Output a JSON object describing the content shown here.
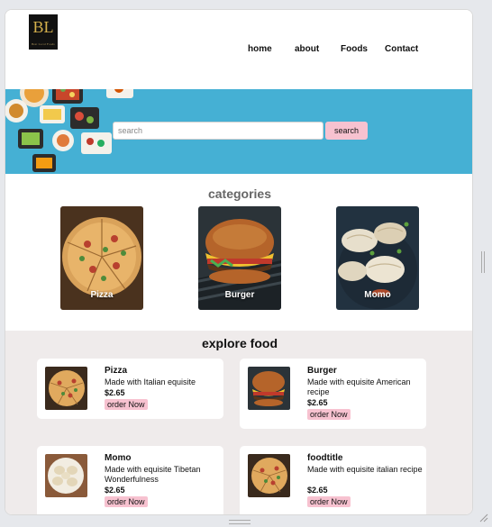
{
  "header": {
    "logo_text": "BL",
    "logo_tagline": "Best Local Foods",
    "nav": [
      "home",
      "about",
      "Foods",
      "Contact"
    ]
  },
  "hero": {
    "search_placeholder": "search",
    "search_button": "search"
  },
  "categories": {
    "title": "categories",
    "items": [
      "Pizza",
      "Burger",
      "Momo"
    ]
  },
  "explore": {
    "title": "explore food",
    "items": [
      {
        "name": "Pizza",
        "desc": "Made with Italian equisite",
        "price": "$2.65",
        "button": "order Now",
        "image": "pizza-image"
      },
      {
        "name": "Burger",
        "desc": "Made with equisite American recipe",
        "price": "$2.65",
        "button": "order Now",
        "image": "burger-image"
      },
      {
        "name": "Momo",
        "desc": "Made with equisite Tibetan Wonderfulness",
        "price": "$2.65",
        "button": "order Now",
        "image": "momo-image"
      },
      {
        "name": "foodtitle",
        "desc": "Made with equisite italian recipe",
        "price": "$2.65",
        "button": "order Now",
        "image": "pizza-image"
      }
    ]
  },
  "colors": {
    "hero_bg": "#45b0d4",
    "accent_pink": "#f7c2d0",
    "explore_bg": "#efebeb"
  }
}
